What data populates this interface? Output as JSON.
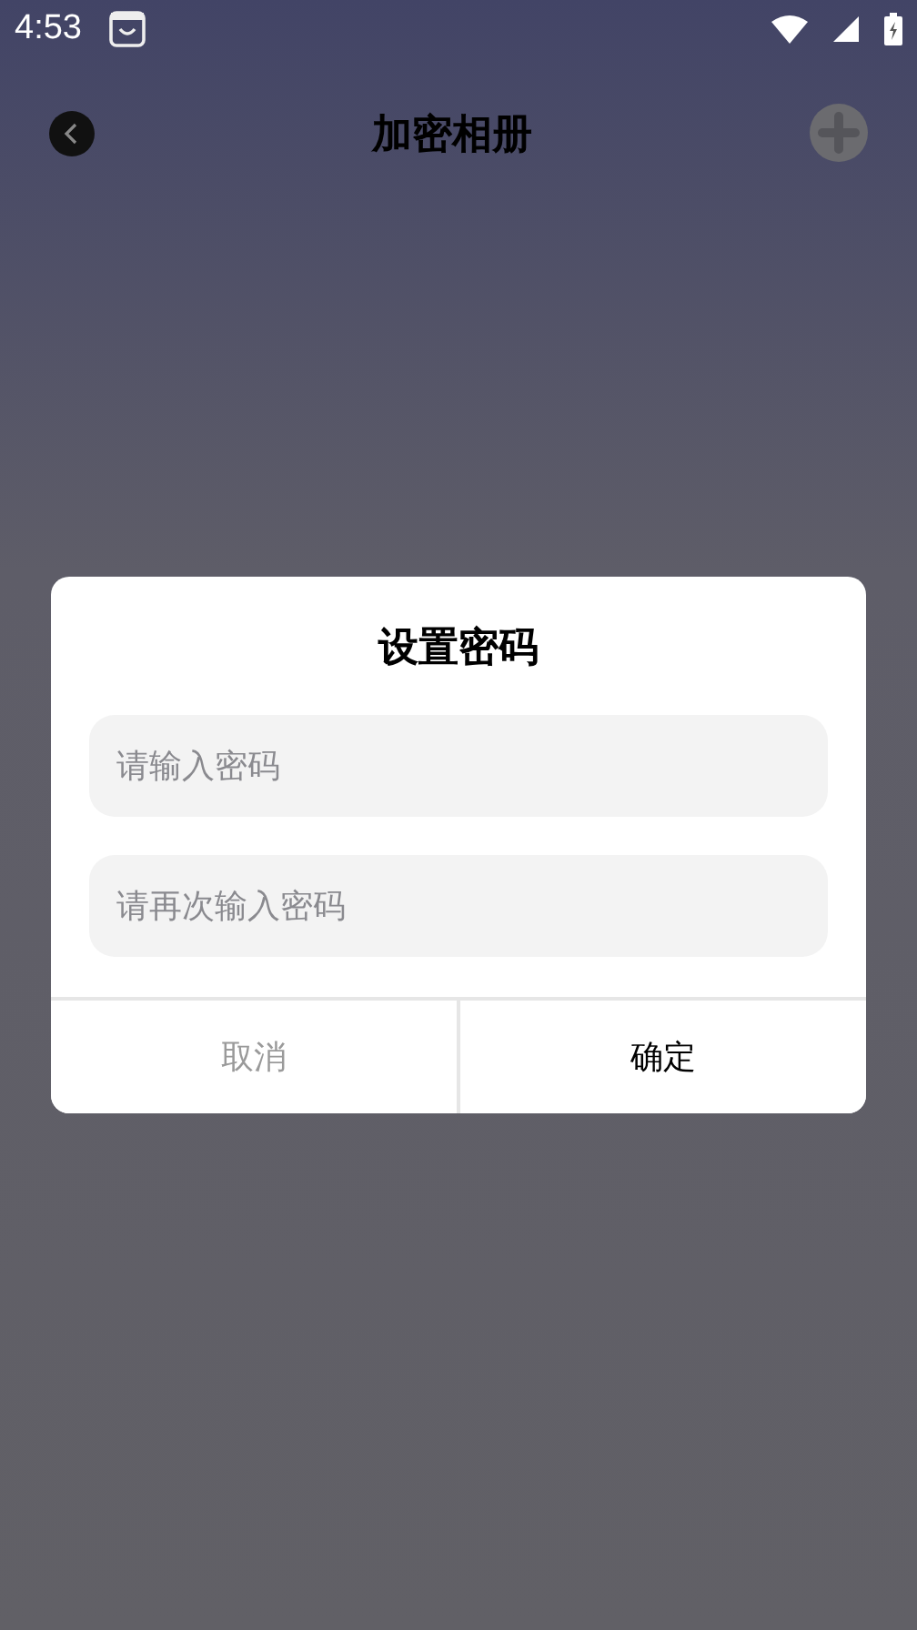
{
  "status_bar": {
    "time": "4:53"
  },
  "header": {
    "title": "加密相册"
  },
  "dialog": {
    "title": "设置密码",
    "fields": [
      {
        "placeholder": "请输入密码"
      },
      {
        "placeholder": "请再次输入密码"
      }
    ],
    "buttons": [
      {
        "label": "取消",
        "kind": "cancel"
      },
      {
        "label": "确定",
        "kind": "confirm"
      }
    ]
  }
}
